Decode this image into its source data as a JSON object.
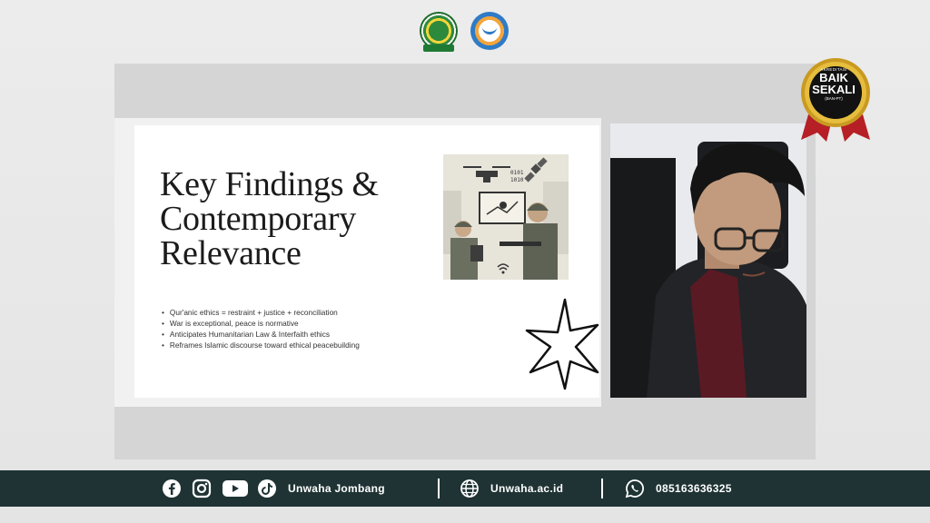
{
  "slide": {
    "title_lines": [
      "Key Findings &",
      "Contemporary",
      "Relevance"
    ],
    "bullets": [
      "Qur'anic ethics = restraint + justice + reconciliation",
      "War is exceptional, peace is normative",
      "Anticipates Humanitarian Law & Interfaith ethics",
      "Reframes Islamic discourse toward ethical peacebuilding"
    ],
    "illustration_code": [
      "0101",
      "1010"
    ]
  },
  "badge": {
    "top": "AKREDITASI",
    "line1": "BAIK",
    "line2": "SEKALI",
    "foot": "(BAN-PT)"
  },
  "footer": {
    "social_name": "Unwaha Jombang",
    "website": "Unwaha.ac.id",
    "phone": "085163636325"
  },
  "colors": {
    "footer_bg": "#1f3334",
    "badge_gold": "#e3b634",
    "badge_ribbon": "#c8262b"
  },
  "icons": [
    "facebook-icon",
    "instagram-icon",
    "youtube-icon",
    "tiktok-icon",
    "globe-icon",
    "whatsapp-icon"
  ]
}
